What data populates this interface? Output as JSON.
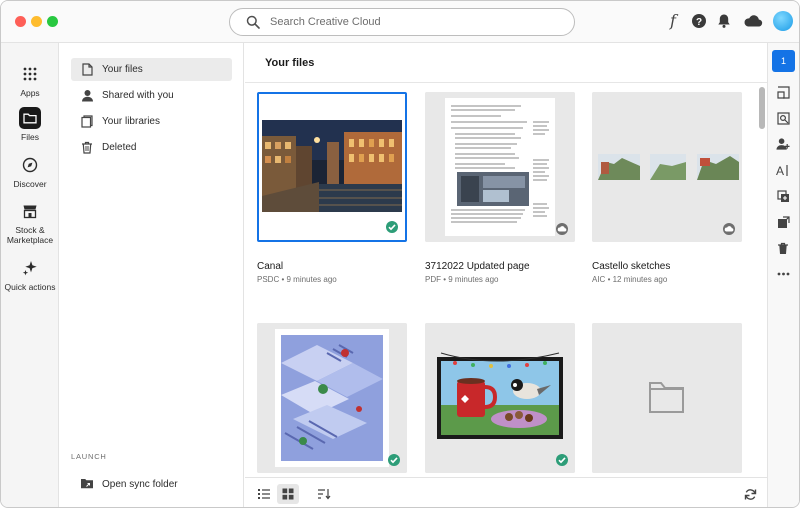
{
  "search": {
    "placeholder": "Search Creative Cloud"
  },
  "rail": [
    {
      "label": "Apps",
      "icon": "apps-grid-icon"
    },
    {
      "label": "Files",
      "icon": "folder-icon",
      "active": true
    },
    {
      "label": "Discover",
      "icon": "discover-icon"
    },
    {
      "label": "Stock & Marketplace",
      "icon": "stock-icon"
    },
    {
      "label": "Quick actions",
      "icon": "sparkle-icon"
    }
  ],
  "nav": {
    "items": [
      {
        "label": "Your files",
        "icon": "file-icon",
        "active": true
      },
      {
        "label": "Shared with you",
        "icon": "person-icon"
      },
      {
        "label": "Your libraries",
        "icon": "library-icon"
      },
      {
        "label": "Deleted",
        "icon": "trash-icon"
      }
    ],
    "launch_heading": "LAUNCH",
    "sync_label": "Open sync folder"
  },
  "main": {
    "title": "Your files",
    "files": [
      {
        "name": "Canal",
        "type": "PSDC",
        "time": "9 minutes ago",
        "status": "synced",
        "selected": true
      },
      {
        "name": "3712022 Updated page",
        "type": "PDF",
        "time": "9 minutes ago",
        "status": "cloud"
      },
      {
        "name": "Castello sketches",
        "type": "AIC",
        "time": "12 minutes ago",
        "status": "cloud"
      },
      {
        "name": "",
        "type": "",
        "time": "",
        "status": "synced"
      },
      {
        "name": "",
        "type": "",
        "time": "",
        "status": "synced"
      },
      {
        "name": "",
        "type": "",
        "time": "",
        "status": "folder"
      }
    ],
    "meta_separator": " • "
  },
  "right_panel": {
    "badge_count": "1"
  },
  "colors": {
    "accent": "#1473e6",
    "synced": "#2d9d78"
  }
}
